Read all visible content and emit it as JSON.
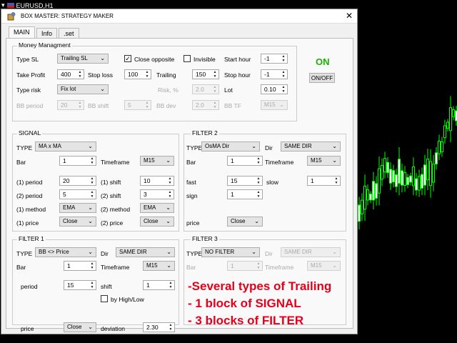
{
  "chart": {
    "symbol": "EURUSD,H1"
  },
  "window": {
    "title": "BOX MASTER: STRATEGY MAKER",
    "close": "✕"
  },
  "tabs": [
    "MAIN",
    "Info",
    ".set"
  ],
  "money": {
    "title": "Money Managment",
    "type_sl_label": "Type SL",
    "type_sl": "Trailing SL",
    "close_opposite_label": "Close opposite",
    "close_opposite_checked": true,
    "invisible_label": "Invisible",
    "invisible_checked": false,
    "start_hour_label": "Start hour",
    "start_hour": "-1",
    "take_profit_label": "Take Profit",
    "take_profit": "400",
    "stop_loss_label": "Stop loss",
    "stop_loss": "100",
    "trailing_label": "Trailing",
    "trailing": "150",
    "stop_hour_label": "Stop hour",
    "stop_hour": "-1",
    "type_risk_label": "Type risk",
    "type_risk": "Fix lot",
    "risk_label": "Risk, %",
    "risk": "2.0",
    "lot_label": "Lot",
    "lot": "0.10",
    "bb_period_label": "BB period",
    "bb_period": "20",
    "bb_shift_label": "BB shift",
    "bb_shift": "5",
    "bb_dev_label": "BB dev",
    "bb_dev": "2.0",
    "bb_tf_label": "BB TF",
    "bb_tf": "M15"
  },
  "status": {
    "state": "ON",
    "toggle_label": "ON/OFF"
  },
  "signal": {
    "title": "SIGNAL",
    "type_label": "TYPE",
    "type": "MA x MA",
    "bar_label": "Bar",
    "bar": "1",
    "timeframe_label": "Timeframe",
    "timeframe": "M15",
    "p1_label": "(1) period",
    "p1": "20",
    "s1_label": "(1) shift",
    "s1": "10",
    "p2_label": "(2) period",
    "p2": "5",
    "s2_label": "(2) shift",
    "s2": "3",
    "m1_label": "(1) method",
    "m1": "EMA",
    "m2_label": "(2) method",
    "m2": "EMA",
    "pr1_label": "(1) price",
    "pr1": "Close",
    "pr2_label": "(2) price",
    "pr2": "Close"
  },
  "filter2": {
    "title": "FILTER 2",
    "type_label": "TYPE",
    "type": "OsMA Dir",
    "dir_label": "Dir",
    "dir": "SAME DIR",
    "bar_label": "Bar",
    "bar": "1",
    "timeframe_label": "Timeframe",
    "timeframe": "M15",
    "fast_label": "fast",
    "fast": "15",
    "slow_label": "slow",
    "slow": "1",
    "sign_label": "sign",
    "sign": "1",
    "price_label": "price",
    "price": "Close"
  },
  "filter1": {
    "title": "FILTER 1",
    "type_label": "TYPE",
    "type": "BB <> Price",
    "dir_label": "Dir",
    "dir": "SAME DIR",
    "bar_label": "Bar",
    "bar": "1",
    "timeframe_label": "Timeframe",
    "timeframe": "M15",
    "period_label": "period",
    "period": "15",
    "shift_label": "shift",
    "shift": "1",
    "hl_label": "by High/Low",
    "hl_checked": false,
    "price_label": "price",
    "price": "Close",
    "deviation_label": "deviation",
    "deviation": "2.30"
  },
  "filter3": {
    "title": "FILTER 3",
    "type_label": "TYPE",
    "type": "NO FILTER",
    "dir_label": "Dir",
    "dir": "SAME DIR",
    "bar_label": "Bar",
    "bar": "1",
    "timeframe_label": "Timeframe",
    "timeframe": "M15"
  },
  "promo": {
    "line1": "-Several types of Trailing",
    "line2": "- 1 block of SIGNAL",
    "line3": "- 3 blocks of FILTER"
  },
  "colors": {
    "chart_bg": "#000000",
    "candle": "#00ff00",
    "on_status": "#1db000",
    "promo": "#e3001b"
  }
}
